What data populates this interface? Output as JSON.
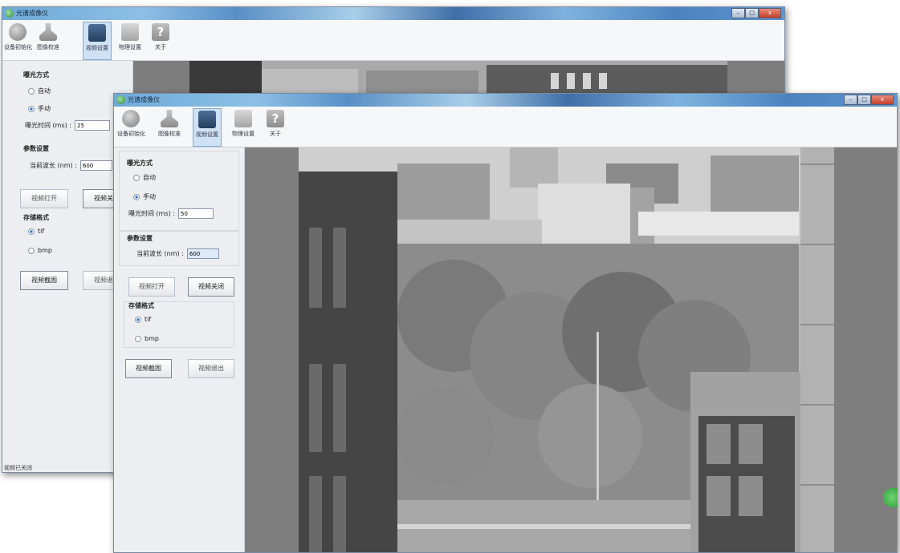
{
  "app": {
    "title": "光谱成像仪"
  },
  "window_controls": {
    "minimize": "–",
    "maximize": "□",
    "close": "x"
  },
  "toolbar": {
    "items": [
      {
        "label": "设备初始化",
        "icon": "device-init-icon"
      },
      {
        "label": "图像校准",
        "icon": "image-calibration-icon"
      },
      {
        "label": "视频设置",
        "icon": "video-settings-icon",
        "active": true
      },
      {
        "label": "物理设置",
        "icon": "physical-settings-icon"
      },
      {
        "label": "关于",
        "icon": "help-icon"
      }
    ]
  },
  "exposure": {
    "title": "曝光方式",
    "options": [
      "自动",
      "手动"
    ],
    "selected": "手动",
    "time_label": "曝光时间 (ms) :"
  },
  "params": {
    "title": "参数设置",
    "wavelength_label": "当前波长 (nm) :"
  },
  "video": {
    "open": "视频打开",
    "close": "视频关闭"
  },
  "storage": {
    "title": "存储格式",
    "options": [
      "tif",
      "bmp"
    ],
    "selected": "tif"
  },
  "actions": {
    "capture": "视频截图",
    "exit": "视频退出"
  },
  "back_window": {
    "exposure_value": "25",
    "wavelength_value": "600",
    "status": "视频已关闭"
  },
  "front_window": {
    "exposure_value": "50",
    "wavelength_value": "600"
  }
}
